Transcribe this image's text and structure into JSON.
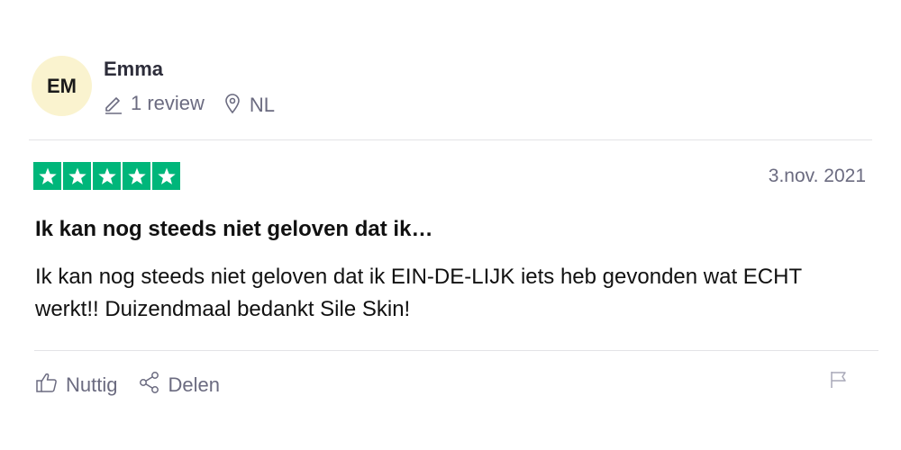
{
  "reviewer": {
    "initials": "EM",
    "name": "Emma",
    "review_count": "1 review",
    "country": "NL",
    "avatar_color": "#faf3cf"
  },
  "review": {
    "rating": 5,
    "rating_max": 5,
    "star_color": "#00b67a",
    "date": "3.nov. 2021",
    "title": "Ik kan nog steeds niet geloven dat ik…",
    "body": "Ik kan nog steeds niet geloven dat ik EIN-DE-LIJK iets heb gevonden wat ECHT werkt!! Duizendmaal bedankt Sile Skin!"
  },
  "actions": {
    "useful_label": "Nuttig",
    "share_label": "Delen",
    "icons": [
      "thumbs-up-icon",
      "share-icon",
      "flag-icon"
    ]
  }
}
